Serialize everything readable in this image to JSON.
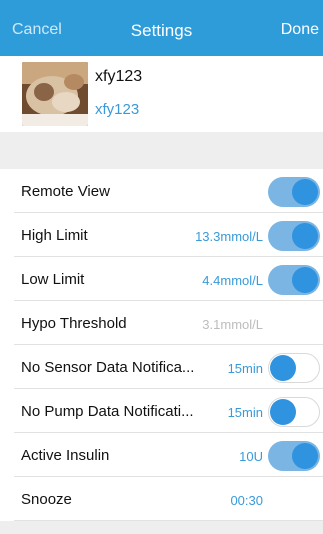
{
  "nav": {
    "cancel": "Cancel",
    "title": "Settings",
    "done": "Done"
  },
  "profile": {
    "name": "xfy123",
    "subtitle": "xfy123"
  },
  "rows": [
    {
      "label": "Remote View",
      "value": "",
      "toggle": true
    },
    {
      "label": "High Limit",
      "value": "13.3mmol/L",
      "toggle": true
    },
    {
      "label": "Low Limit",
      "value": "4.4mmol/L",
      "toggle": true
    },
    {
      "label": "Hypo Threshold",
      "value": "3.1mmol/L",
      "toggle": null
    },
    {
      "label": "No Sensor Data Notifica...",
      "value": "15min",
      "toggle": false
    },
    {
      "label": "No Pump Data Notificati...",
      "value": "15min",
      "toggle": false
    },
    {
      "label": "Active Insulin",
      "value": "10U",
      "toggle": true
    },
    {
      "label": "Snooze",
      "value": "00:30",
      "toggle": null
    }
  ],
  "colors": {
    "accent": "#2f9cda",
    "value_text": "#3a9ad9",
    "toggle_on_track": "#7ab5e4",
    "toggle_knob": "#2f93e0"
  }
}
